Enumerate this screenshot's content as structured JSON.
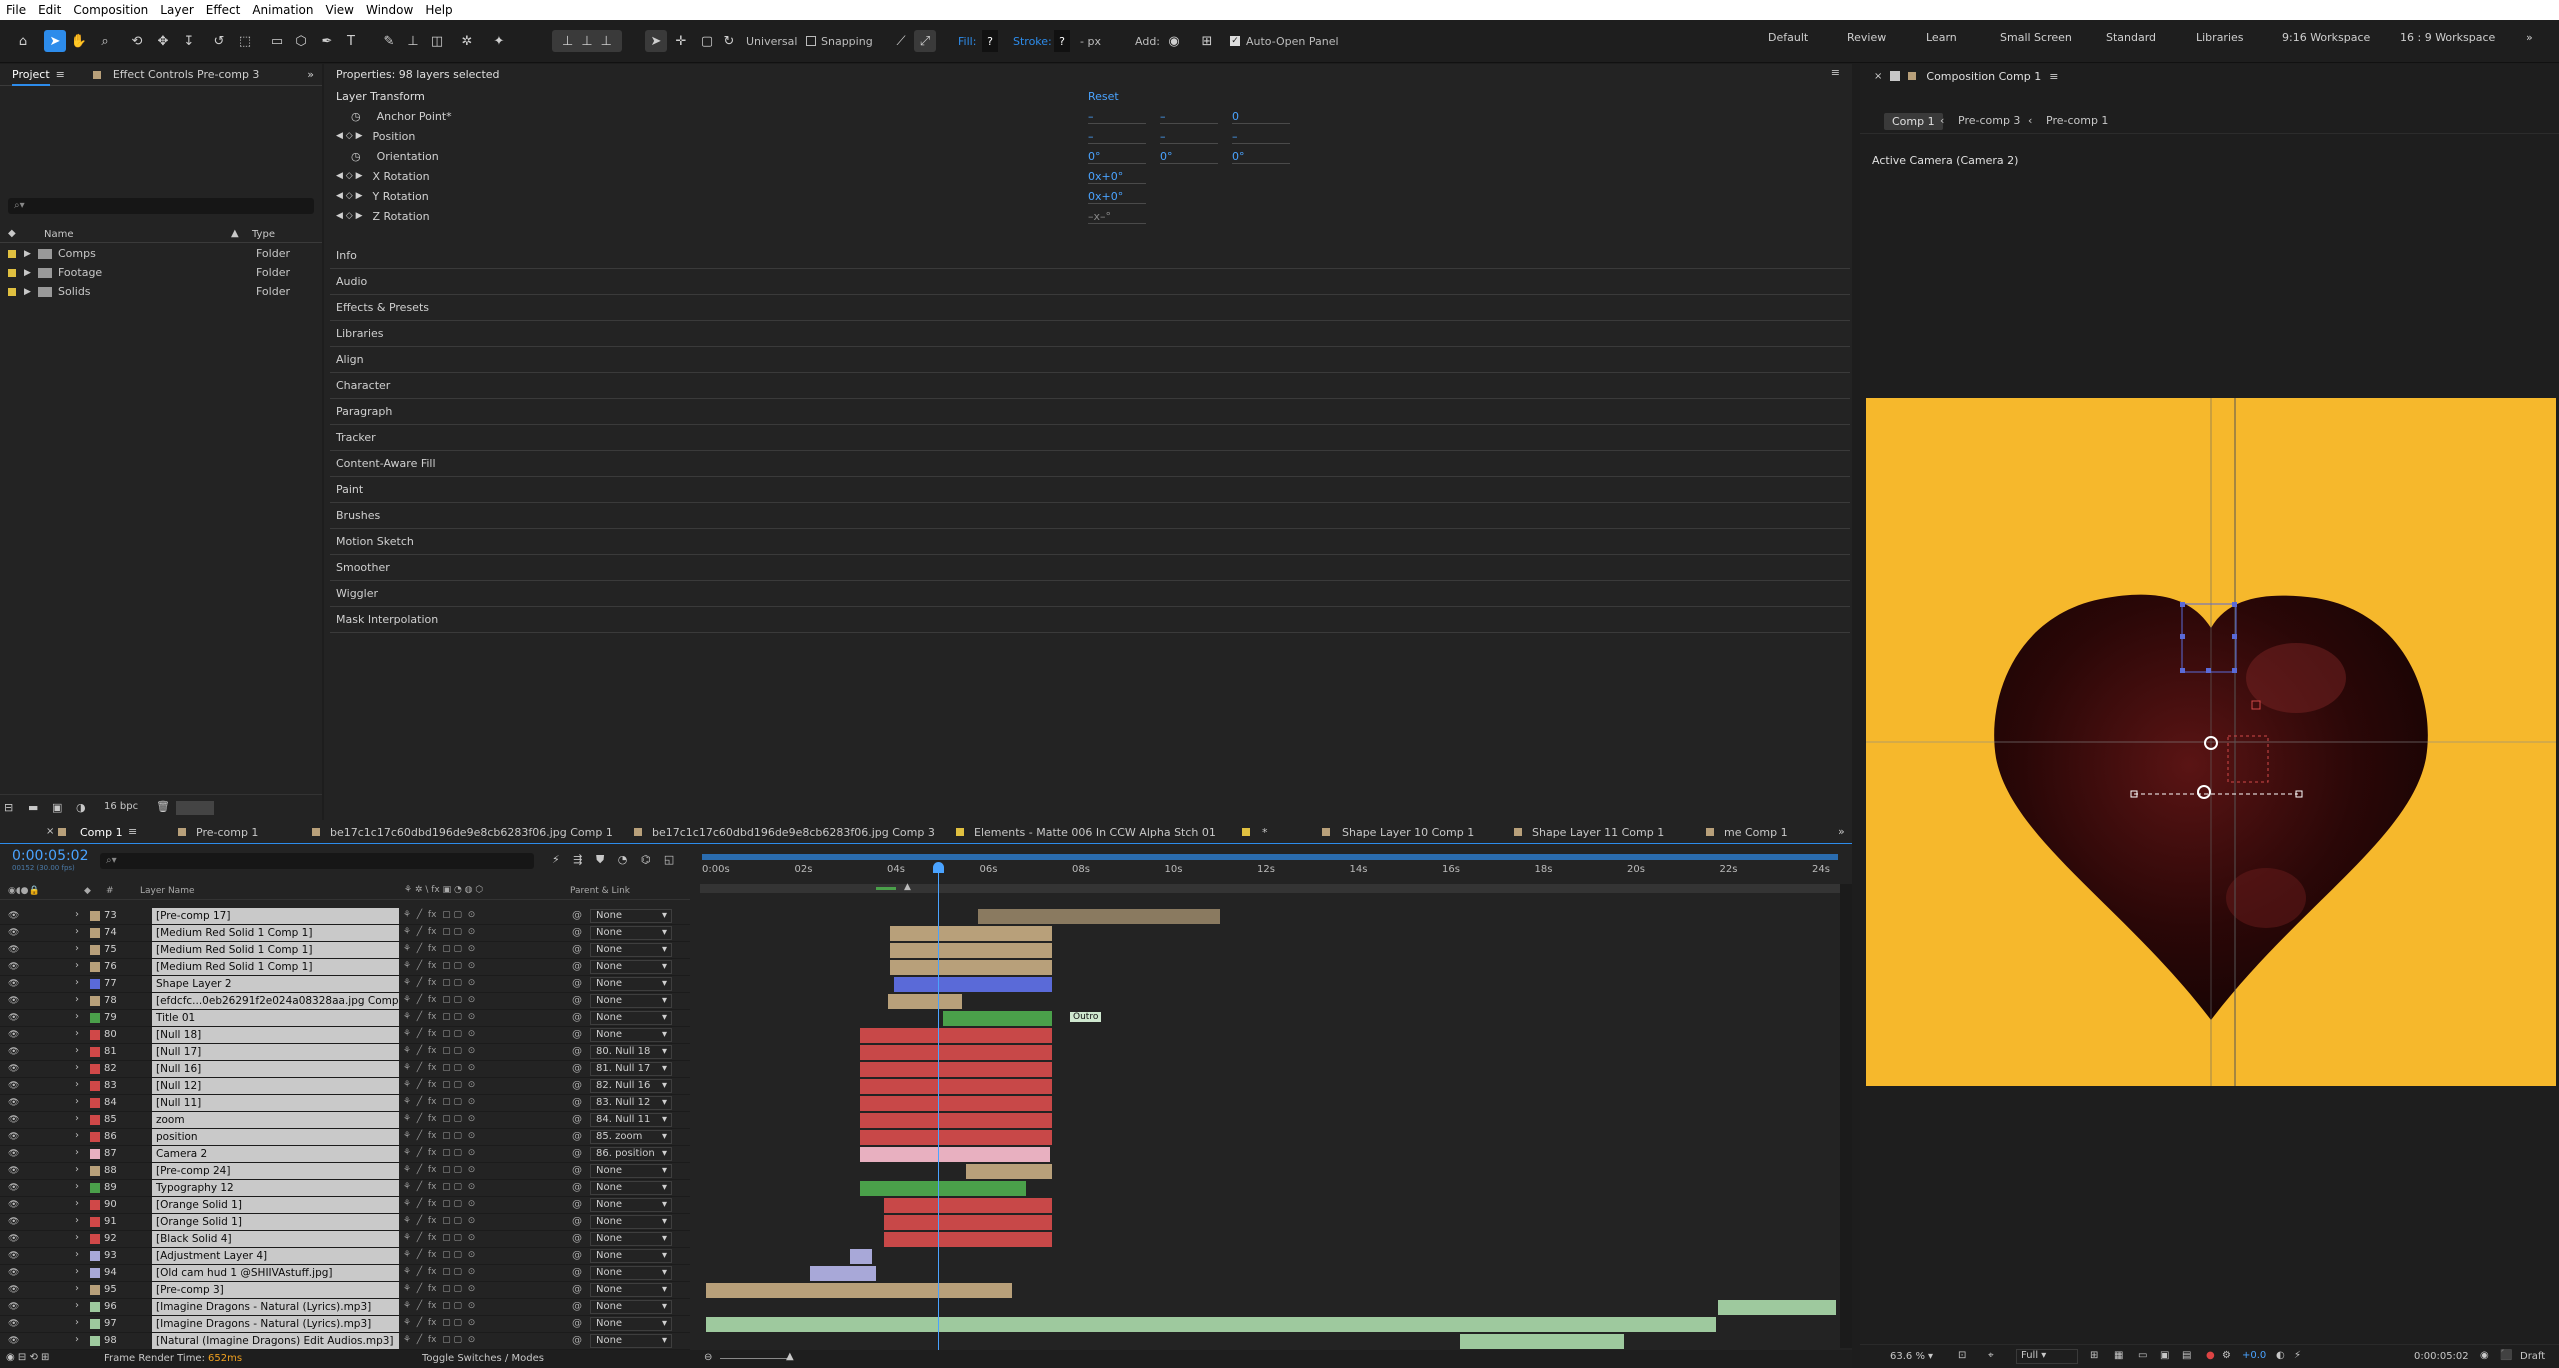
{
  "menu": [
    "File",
    "Edit",
    "Composition",
    "Layer",
    "Effect",
    "Animation",
    "View",
    "Window",
    "Help"
  ],
  "toolbar": {
    "universal": "Universal",
    "snapping": "Snapping",
    "fill": "Fill:",
    "fill_val": "?",
    "stroke": "Stroke:",
    "stroke_val": "?",
    "stroke_unit": "- px",
    "add": "Add:",
    "auto_open": "Auto-Open Panel"
  },
  "workspaces": [
    "Default",
    "Review",
    "Learn",
    "Small Screen",
    "Standard",
    "Libraries",
    "9:16 Workspace",
    "16 : 9 Workspace"
  ],
  "project": {
    "tab": "Project",
    "effect_controls": "Effect Controls Pre-comp 3",
    "col_name": "Name",
    "col_type": "Type",
    "items": [
      {
        "name": "Comps",
        "type": "Folder"
      },
      {
        "name": "Footage",
        "type": "Folder"
      },
      {
        "name": "Solids",
        "type": "Folder"
      }
    ],
    "bpc": "16 bpc"
  },
  "properties": {
    "title": "Properties: 98 layers selected",
    "section": "Layer Transform",
    "reset": "Reset",
    "rows": [
      "Anchor Point*",
      "Position",
      "Orientation",
      "X Rotation",
      "Y Rotation",
      "Z Rotation"
    ],
    "values": {
      "ap": [
        "–",
        "–",
        "0"
      ],
      "pos": [
        "–",
        "–",
        "–"
      ],
      "ori": [
        "0°",
        "0°",
        "0°"
      ],
      "xr": "0x+0°",
      "yr": "0x+0°",
      "zr": "–x–°"
    },
    "panels": [
      "Info",
      "Audio",
      "Effects & Presets",
      "Libraries",
      "Align",
      "Character",
      "Paragraph",
      "Tracker",
      "Content-Aware Fill",
      "Paint",
      "Brushes",
      "Motion Sketch",
      "Smoother",
      "Wiggler",
      "Mask Interpolation"
    ]
  },
  "comp": {
    "title": "Composition Comp 1",
    "crumbs": [
      "Comp 1",
      "Pre-comp 3",
      "Pre-comp 1"
    ],
    "camera": "Active Camera (Camera 2)",
    "zoom": "63.6 %",
    "res": "Full",
    "exposure": "+0.0",
    "time": "0:00:05:02",
    "draft": "Draft"
  },
  "timeline": {
    "tabs": [
      "Comp 1",
      "Pre-comp 1",
      "be17c1c17c60dbd196de9e8cb6283f06.jpg Comp 1",
      "be17c1c17c60dbd196de9e8cb6283f06.jpg Comp 3",
      "Elements - Matte 006 In CCW Alpha Stch 01",
      "*",
      "Shape Layer 10 Comp 1",
      "Shape Layer 11 Comp 1",
      "me Comp 1"
    ],
    "timecode": "0:00:05:02",
    "fps": "00152 (30.00 fps)",
    "col_layer": "Layer Name",
    "col_parent": "Parent & Link",
    "ticks": [
      "0:00s",
      "02s",
      "04s",
      "06s",
      "08s",
      "10s",
      "12s",
      "14s",
      "16s",
      "18s",
      "20s",
      "22s",
      "24s"
    ],
    "render_label": "Frame Render Time:",
    "render_val": "652ms",
    "toggle": "Toggle Switches / Modes",
    "outro": "Outro",
    "layers": [
      {
        "n": "73",
        "name": "[Pre-comp 17]",
        "parent": "None",
        "lc": "#b8a07a"
      },
      {
        "n": "74",
        "name": "[Medium Red Solid 1 Comp 1]",
        "parent": "None",
        "lc": "#b8a07a"
      },
      {
        "n": "75",
        "name": "[Medium Red Solid 1 Comp 1]",
        "parent": "None",
        "lc": "#b8a07a"
      },
      {
        "n": "76",
        "name": "[Medium Red Solid 1 Comp 1]",
        "parent": "None",
        "lc": "#b8a07a"
      },
      {
        "n": "77",
        "name": "Shape Layer 2",
        "parent": "None",
        "lc": "#5a6ad8"
      },
      {
        "n": "78",
        "name": "[efdcfc...0eb26291f2e024a08328aa.jpg Comp 1]",
        "parent": "None",
        "lc": "#b8a07a"
      },
      {
        "n": "79",
        "name": "Title 01",
        "parent": "None",
        "lc": "#4aa04a"
      },
      {
        "n": "80",
        "name": "[Null 18]",
        "parent": "None",
        "lc": "#d04848"
      },
      {
        "n": "81",
        "name": "[Null 17]",
        "parent": "80. Null 18",
        "lc": "#d04848"
      },
      {
        "n": "82",
        "name": "[Null 16]",
        "parent": "81. Null 17",
        "lc": "#d04848"
      },
      {
        "n": "83",
        "name": "[Null 12]",
        "parent": "82. Null 16",
        "lc": "#d04848"
      },
      {
        "n": "84",
        "name": "[Null 11]",
        "parent": "83. Null 12",
        "lc": "#d04848"
      },
      {
        "n": "85",
        "name": "zoom",
        "parent": "84. Null 11",
        "lc": "#d04848"
      },
      {
        "n": "86",
        "name": "position",
        "parent": "85. zoom",
        "lc": "#d04848"
      },
      {
        "n": "87",
        "name": "Camera 2",
        "parent": "86. position",
        "lc": "#e8b0c0"
      },
      {
        "n": "88",
        "name": "[Pre-comp 24]",
        "parent": "None",
        "lc": "#b8a07a"
      },
      {
        "n": "89",
        "name": "Typography 12",
        "parent": "None",
        "lc": "#4aa04a"
      },
      {
        "n": "90",
        "name": "[Orange Solid 1]",
        "parent": "None",
        "lc": "#d04848"
      },
      {
        "n": "91",
        "name": "[Orange Solid 1]",
        "parent": "None",
        "lc": "#d04848"
      },
      {
        "n": "92",
        "name": "[Black Solid 4]",
        "parent": "None",
        "lc": "#d04848"
      },
      {
        "n": "93",
        "name": "[Adjustment Layer 4]",
        "parent": "None",
        "lc": "#a8a8d8"
      },
      {
        "n": "94",
        "name": "[Old cam hud 1 @SHIIVAstuff.jpg]",
        "parent": "None",
        "lc": "#a8a8d8"
      },
      {
        "n": "95",
        "name": "[Pre-comp 3]",
        "parent": "None",
        "lc": "#b8a07a"
      },
      {
        "n": "96",
        "name": "[Imagine Dragons - Natural (Lyrics).mp3]",
        "parent": "None",
        "lc": "#9ec99e"
      },
      {
        "n": "97",
        "name": "[Imagine Dragons - Natural (Lyrics).mp3]",
        "parent": "None",
        "lc": "#9ec99e"
      },
      {
        "n": "98",
        "name": "[Natural (Imagine Dragons) Edit Audios.mp3]",
        "parent": "None",
        "lc": "#9ec99e"
      }
    ]
  }
}
